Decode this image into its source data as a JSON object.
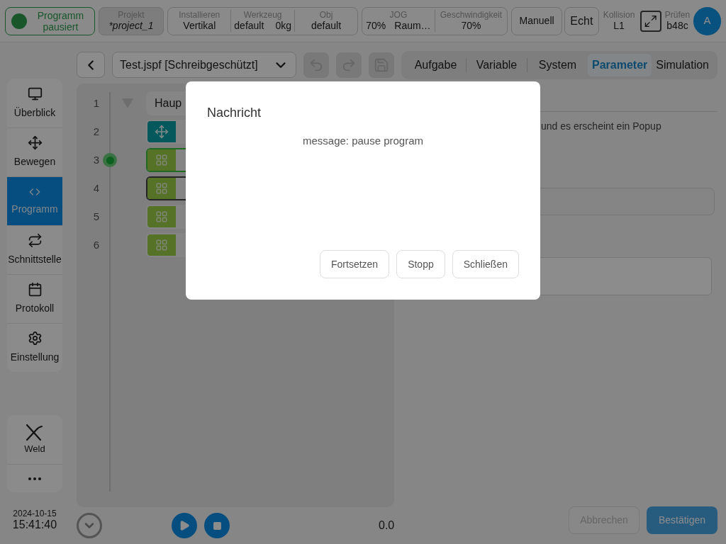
{
  "top_bar": {
    "program_state": {
      "label": "Programm pausiert"
    },
    "project": {
      "label": "Projekt",
      "value": "*project_1"
    },
    "install_group": [
      {
        "label": "Installieren",
        "values": [
          "Vertikal"
        ]
      },
      {
        "label": "Werkzeug",
        "values": [
          "default",
          "0kg"
        ]
      },
      {
        "label": "Obj",
        "values": [
          "default"
        ]
      }
    ],
    "jog_group": [
      {
        "label": "JOG",
        "values": [
          "70%",
          "Raum…"
        ]
      },
      {
        "label": "Geschwindigkeit",
        "values": [
          "70%"
        ]
      }
    ],
    "mode_buttons": [
      "Manuell",
      "Echt"
    ],
    "collision": {
      "label": "Kollision",
      "value": "L1"
    },
    "check": {
      "label": "Prüfen",
      "value": "b48c"
    },
    "avatar": "A"
  },
  "sidebar": {
    "items": [
      {
        "label": "Überblick",
        "selected": false
      },
      {
        "label": "Bewegen",
        "selected": false
      },
      {
        "label": "Programm",
        "selected": true
      },
      {
        "label": "Schnittstelle",
        "selected": false
      },
      {
        "label": "Protokoll",
        "selected": false
      },
      {
        "label": "Einstellung",
        "selected": false
      }
    ],
    "extra_items": [
      {
        "label": "Weld"
      }
    ],
    "date": "2024-10-15",
    "time": "15:41:40"
  },
  "toolbar": {
    "file": "Test.jspf [Schreibgeschützt]"
  },
  "tabs": [
    {
      "label": "Aufgabe",
      "selected": false
    },
    {
      "label": "Variable",
      "selected": false
    },
    {
      "label": "System",
      "selected": false
    },
    {
      "label": "Parameter",
      "selected": true
    },
    {
      "label": "Simulation",
      "selected": false
    }
  ],
  "program_tree": [
    {
      "line": "1",
      "kind": "group",
      "label": "Haup",
      "current": false,
      "selected": false
    },
    {
      "line": "2",
      "kind": "move",
      "current": false,
      "selected": false
    },
    {
      "line": "3",
      "kind": "block",
      "current": true,
      "selected": false
    },
    {
      "line": "4",
      "kind": "block",
      "current": false,
      "selected": true
    },
    {
      "line": "5",
      "kind": "block",
      "current": false,
      "selected": false
    },
    {
      "line": "6",
      "kind": "block",
      "current": false,
      "selected": false
    }
  ],
  "parameter_panel": {
    "description": "und es erscheint ein Popup"
  },
  "bottom_bar": {
    "reading": "0.0",
    "buttons": [
      {
        "label": "Abbrechen",
        "kind": "secondary"
      },
      {
        "label": "Bestätigen",
        "kind": "primary"
      }
    ]
  },
  "dialog": {
    "title": "Nachricht",
    "message": "message: pause program",
    "buttons": [
      "Fortsetzen",
      "Stopp",
      "Schließen"
    ]
  }
}
